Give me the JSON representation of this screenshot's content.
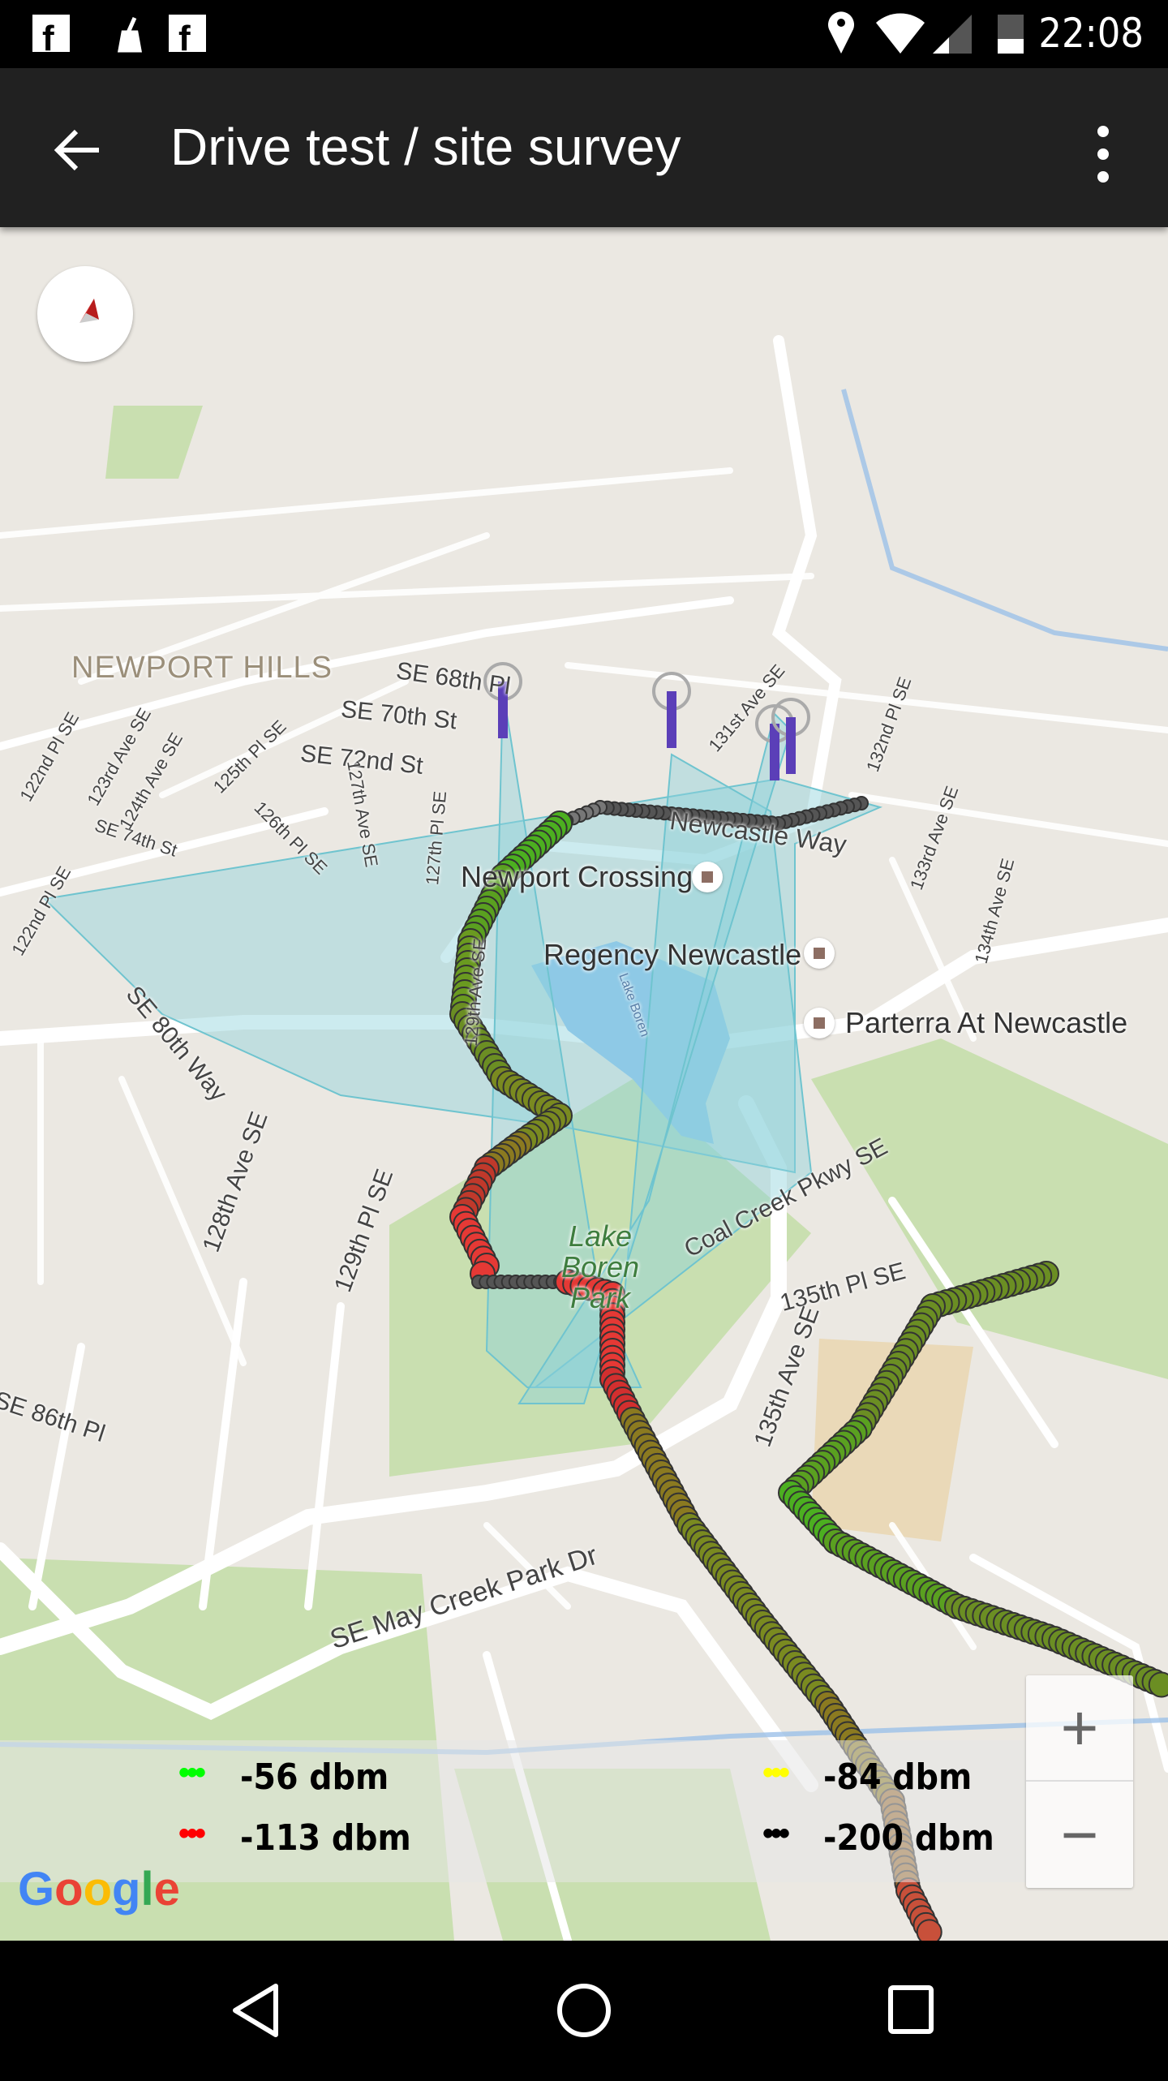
{
  "status_bar": {
    "time": "22:08",
    "icons": [
      "facebook-icon",
      "broom-icon",
      "facebook-icon",
      "location-icon",
      "wifi-icon",
      "signal-icon",
      "battery-icon"
    ]
  },
  "app_bar": {
    "title": "Drive test / site survey",
    "back_icon": "arrow-left-icon",
    "menu_icon": "more-vert-icon"
  },
  "map": {
    "area_label": "NEWPORT HILLS",
    "streets": [
      "SE 68th Pl",
      "SE 70th St",
      "SE 72nd St",
      "SE 74th St",
      "122nd Pl SE",
      "123rd Ave SE",
      "124th Ave SE",
      "125th Pl SE",
      "126th Pl SE",
      "127th Ave SE",
      "127th Pl SE",
      "122nd Pl SE",
      "131st Ave SE",
      "132nd Pl SE",
      "133rd Ave SE",
      "134th Ave SE",
      "Newcastle Way",
      "Lake Boren",
      "129th Ave SE",
      "SE 80th Way",
      "128th Ave SE",
      "129th Pl SE",
      "Coal Creek Pkwy SE",
      "135th Pl SE",
      "135th Ave SE",
      "SE 86th Pl",
      "SE May Creek Park Dr"
    ],
    "park": "Lake Boren Park",
    "pois": [
      "Newport Crossing",
      "Regency Newcastle",
      "Parterra At Newcastle"
    ],
    "attribution": "Google"
  },
  "legend": [
    {
      "label": "-56 dbm",
      "color": "#00ff00"
    },
    {
      "label": "-84 dbm",
      "color": "#ffff00"
    },
    {
      "label": "-113 dbm",
      "color": "#ff0000"
    },
    {
      "label": "-200 dbm",
      "color": "#000000"
    }
  ],
  "zoom_controls": {
    "zoom_in": "+",
    "zoom_out": "−"
  }
}
